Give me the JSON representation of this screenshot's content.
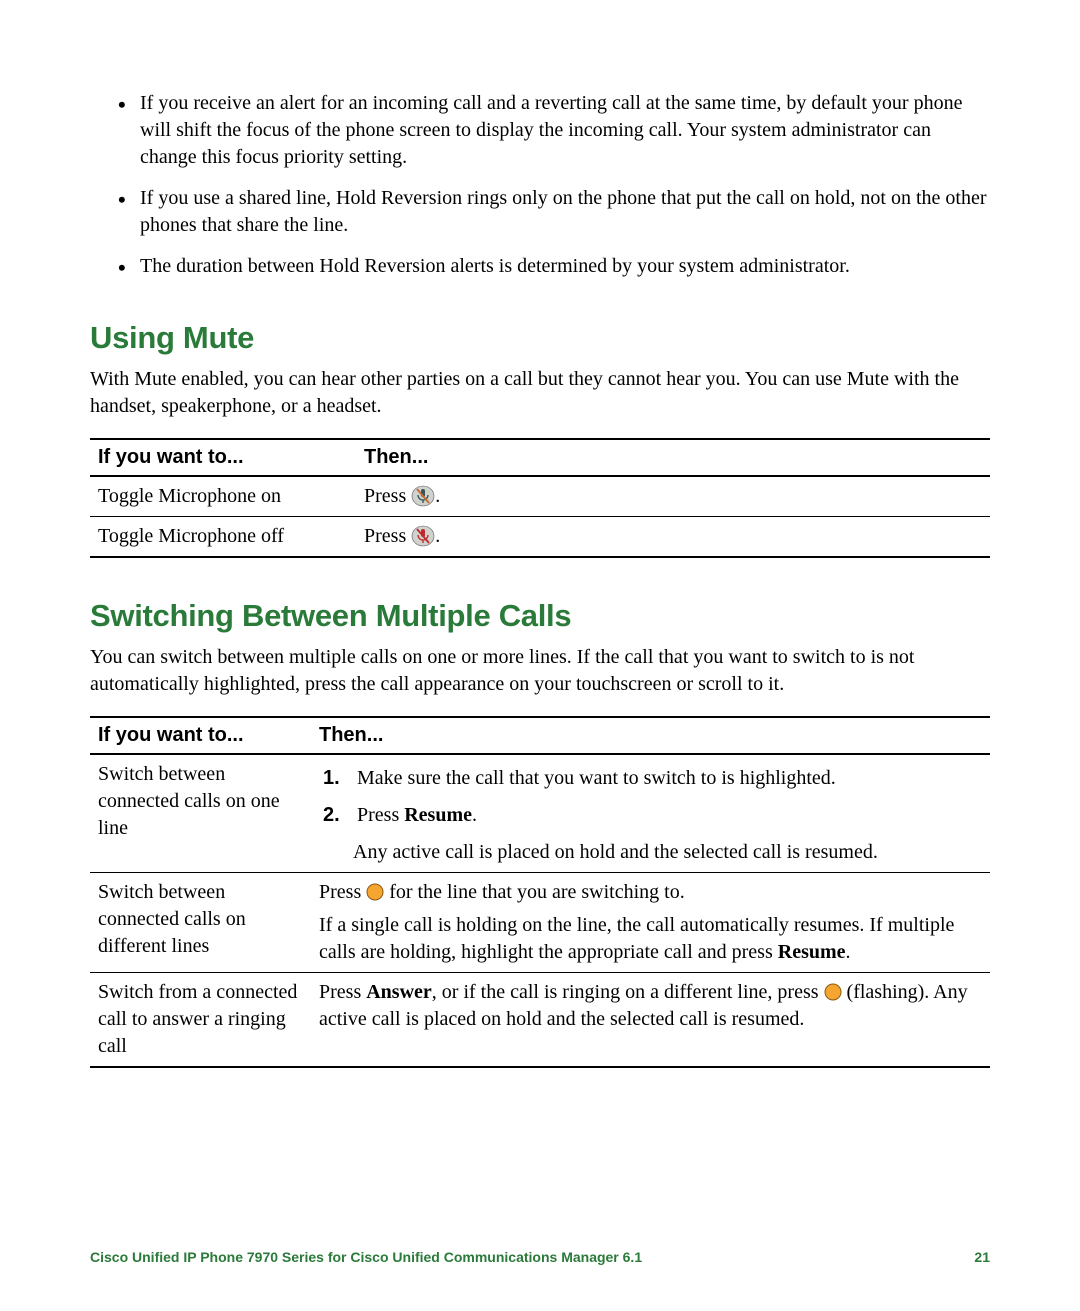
{
  "bullets": [
    "If you receive an alert for an incoming call and a reverting call at the same time, by default your phone will shift the focus of the phone screen to display the incoming call. Your system administrator can change this focus priority setting.",
    "If you use a shared line, Hold Reversion rings only on the phone that put the call on hold, not on the other phones that share the line.",
    "The duration between Hold Reversion alerts is determined by your system administrator."
  ],
  "section1": {
    "title": "Using Mute",
    "intro": "With Mute enabled, you can hear other parties on a call but they cannot hear you. You can use Mute with the handset, speakerphone, or a headset.",
    "headers": {
      "a": "If you want to...",
      "b": "Then..."
    },
    "rows": [
      {
        "want": "Toggle Microphone on",
        "then_pre": "Press ",
        "icon": "mic-off-icon",
        "then_post": "."
      },
      {
        "want": "Toggle Microphone off",
        "then_pre": "Press ",
        "icon": "mic-on-icon",
        "then_post": "."
      }
    ]
  },
  "section2": {
    "title": "Switching Between Multiple Calls",
    "intro": "You can switch between multiple calls on one or more lines. If the call that you want to switch to is not automatically highlighted, press the call appearance on your touchscreen or scroll to it.",
    "headers": {
      "a": "If you want to...",
      "b": "Then..."
    },
    "rows": {
      "r0": {
        "want": "Switch between connected calls on one line",
        "step1": "Make sure the call that you want to switch to is highlighted.",
        "step2_pre": "Press ",
        "step2_bold": "Resume",
        "step2_post": ".",
        "sub": "Any active call is placed on hold and the selected call is resumed."
      },
      "r1": {
        "want": "Switch between connected calls on different lines",
        "p1_pre": "Press ",
        "p1_icon": "line-indicator-icon",
        "p1_post": " for the line that you are switching to.",
        "p2_pre": "If a single call is holding on the line, the call automatically resumes. If multiple calls are holding, highlight the appropriate call and press ",
        "p2_bold": "Resume",
        "p2_post": "."
      },
      "r2": {
        "want": "Switch from a connected call to answer a ringing call",
        "p1_pre": "Press ",
        "p1_bold": "Answer",
        "p1_mid": ", or if the call is ringing on a different line, press ",
        "p1_icon": "line-indicator-icon",
        "p1_post": " (flashing). Any active call is placed on hold and the selected call is resumed."
      }
    }
  },
  "footer": {
    "title": "Cisco Unified IP Phone 7970 Series for Cisco Unified Communications Manager 6.1",
    "page": "21"
  }
}
